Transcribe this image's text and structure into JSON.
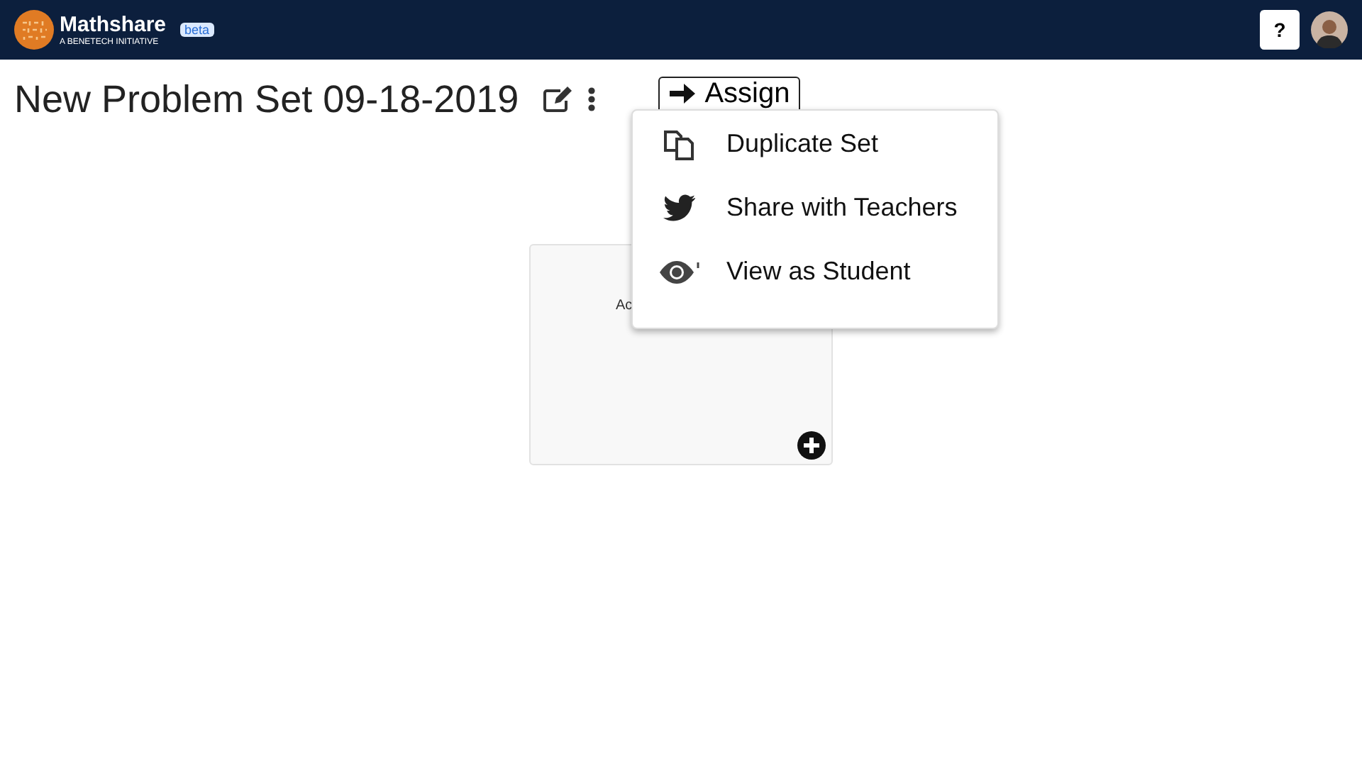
{
  "header": {
    "brand": "Mathshare",
    "tagline": "A BENETECH INITIATIVE",
    "badge": "beta",
    "help": "?"
  },
  "title": "New Problem Set 09-18-2019",
  "assign_button": "Assign",
  "menu": {
    "items": [
      {
        "kind": "duplicate",
        "label": "Duplicate Set"
      },
      {
        "kind": "share",
        "label": "Share with Teachers"
      },
      {
        "kind": "view",
        "label": "View as Student"
      }
    ]
  },
  "card": {
    "text": "Ac"
  }
}
